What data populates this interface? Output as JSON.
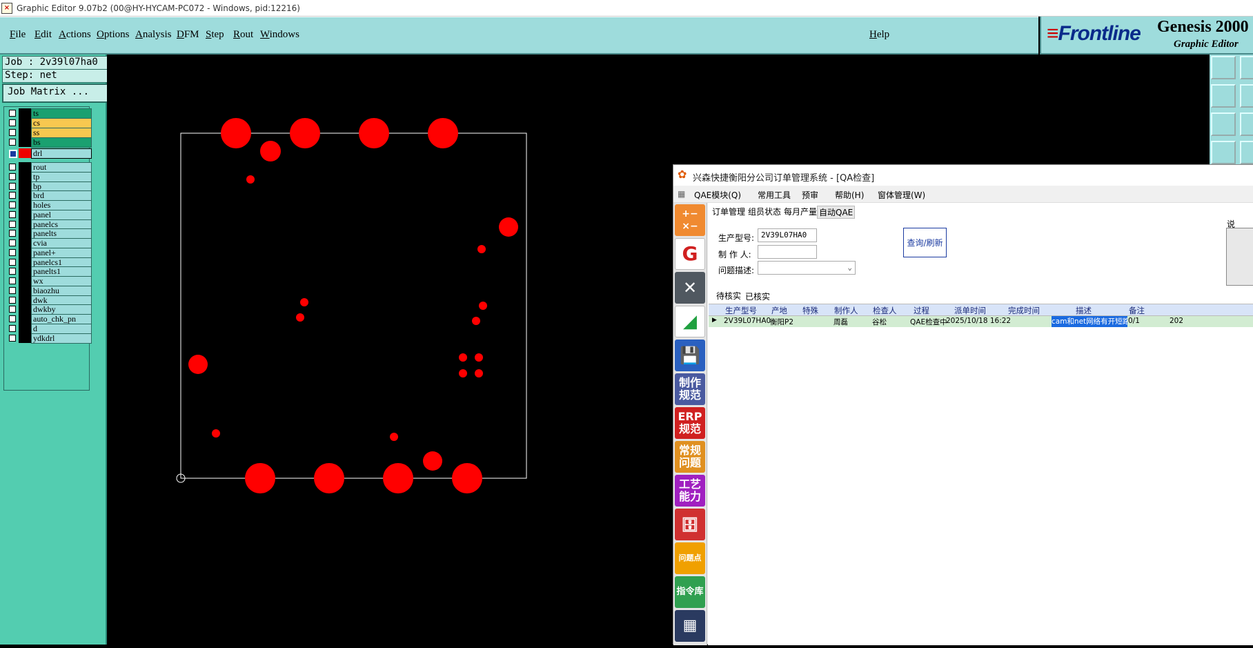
{
  "window": {
    "title": "Graphic Editor 9.07b2 (00@HY-HYCAM-PC072 - Windows, pid:12216)"
  },
  "menubar": {
    "items": [
      "File",
      "Edit",
      "Actions",
      "Options",
      "Analysis",
      "DFM",
      "Step",
      "Rout",
      "Windows"
    ],
    "help": "Help"
  },
  "brand": {
    "logo": "Frontline",
    "product": "Genesis 2000",
    "subtitle": "Graphic Editor"
  },
  "job": {
    "job_label": "Job : 2v39l07ha0",
    "step_label": "Step: net",
    "matrix_button": "Job Matrix ..."
  },
  "layers": [
    {
      "name": "ts",
      "color": "#1aa070"
    },
    {
      "name": "cs",
      "color": "#f8c850"
    },
    {
      "name": "ss",
      "color": "#f8c850"
    },
    {
      "name": "bs",
      "color": "#1aa070"
    },
    {
      "name": "drl",
      "color": "#9edcdc",
      "active": true
    },
    {
      "name": "rout",
      "color": "#9edcdc"
    },
    {
      "name": "tp",
      "color": "#9edcdc"
    },
    {
      "name": "bp",
      "color": "#9edcdc"
    },
    {
      "name": "brd",
      "color": "#9edcdc"
    },
    {
      "name": "holes",
      "color": "#9edcdc"
    },
    {
      "name": "panel",
      "color": "#9edcdc"
    },
    {
      "name": "panelcs",
      "color": "#9edcdc"
    },
    {
      "name": "panelts",
      "color": "#9edcdc"
    },
    {
      "name": "cvia",
      "color": "#9edcdc"
    },
    {
      "name": "panel+",
      "color": "#9edcdc"
    },
    {
      "name": "panelcs1",
      "color": "#9edcdc"
    },
    {
      "name": "panelts1",
      "color": "#9edcdc"
    },
    {
      "name": "wx",
      "color": "#9edcdc"
    },
    {
      "name": "biaozhu",
      "color": "#9edcdc"
    },
    {
      "name": "dwk",
      "color": "#9edcdc"
    },
    {
      "name": "dwkby",
      "color": "#9edcdc"
    },
    {
      "name": "auto_chk_pn",
      "color": "#9edcdc"
    },
    {
      "name": "d",
      "color": "#9edcdc"
    },
    {
      "name": "ydkdrl",
      "color": "#9edcdc"
    }
  ],
  "canvas": {
    "drill_color": "#ff0000",
    "board_outline_color": "#ffffff"
  },
  "qa_window": {
    "title": "兴森快捷衡阳分公司订单管理系统 - [QA检查]",
    "menu": [
      "QAE模块(Q)",
      "常用工具",
      "预审",
      "帮助(H)",
      "窗体管理(W)"
    ],
    "tabs": [
      "订单管理",
      "组员状态",
      "每月产量",
      "自动QAE"
    ],
    "form": {
      "model_label": "生产型号:",
      "model_value": "2V39L07HA0",
      "maker_label": "制 作 人:",
      "maker_value": "",
      "issue_label": "问题描述:",
      "issue_value": "",
      "query_button": "查询/刷新",
      "right_edge_label": "说"
    },
    "subtabs": [
      "待核实",
      "已核实"
    ],
    "grid": {
      "headers": [
        "生产型号",
        "产地",
        "特殊",
        "制作人",
        "检查人",
        "过程",
        "派单时间",
        "完成时间",
        "描述",
        "备注"
      ],
      "rows": [
        [
          "2V39L07HA0",
          "衡阳P2",
          "",
          "周磊",
          "谷松",
          "QAE检查中",
          "2025/10/18 16:22",
          "",
          "cam和net网络有开短路",
          "0/1",
          "202"
        ]
      ]
    },
    "sidebar": [
      {
        "name": "制作规范",
        "color": "#4a5aa0"
      },
      {
        "name": "ERP规范",
        "color": "#d02020"
      },
      {
        "name": "常规问题",
        "color": "#e09020"
      },
      {
        "name": "工艺能力",
        "color": "#a020c0"
      },
      {
        "name": "问题点",
        "color": "#f0a000"
      },
      {
        "name": "指令库",
        "color": "#30a050"
      }
    ]
  }
}
